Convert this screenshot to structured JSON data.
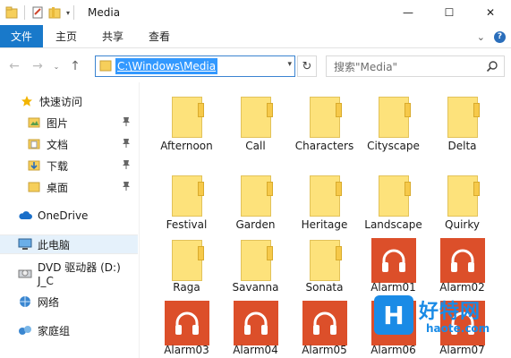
{
  "window": {
    "title": "Media",
    "minimize": "—",
    "maximize": "☐",
    "close": "✕"
  },
  "ribbon": {
    "tabs": [
      "文件",
      "主页",
      "共享",
      "查看"
    ]
  },
  "address": {
    "path": "C:\\Windows\\Media",
    "search_placeholder": "搜索\"Media\""
  },
  "sidebar": {
    "quick_access": "快速访问",
    "pinned": [
      {
        "label": "图片",
        "icon": "pictures-icon"
      },
      {
        "label": "文档",
        "icon": "documents-icon"
      },
      {
        "label": "下载",
        "icon": "downloads-icon"
      },
      {
        "label": "桌面",
        "icon": "desktop-icon"
      }
    ],
    "onedrive": "OneDrive",
    "this_pc": "此电脑",
    "dvd": "DVD 驱动器 (D:) J_C",
    "network": "网络",
    "homegroup": "家庭组"
  },
  "files": {
    "folders": [
      "Afternoon",
      "Call",
      "Characters",
      "Cityscape",
      "Delta",
      "Festival",
      "Garden",
      "Heritage",
      "Landscape",
      "Quirky",
      "Raga",
      "Savanna",
      "Sonata"
    ],
    "audio": [
      "Alarm01",
      "Alarm02",
      "Alarm03",
      "Alarm04",
      "Alarm05",
      "Alarm06",
      "Alarm07"
    ]
  },
  "watermark": {
    "letter": "H",
    "text": "好特网",
    "url": "haote.com"
  },
  "colors": {
    "accent": "#1979ca",
    "folder": "#fde27b",
    "media_tile": "#dc4f2a",
    "selection": "#3399ff"
  }
}
